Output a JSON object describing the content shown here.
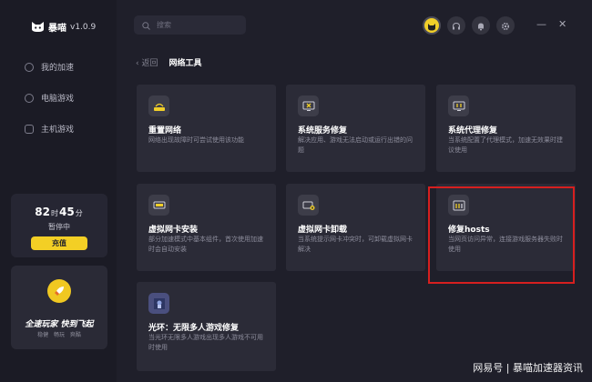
{
  "app": {
    "name": "暴喵",
    "version": "v1.0.9"
  },
  "sidebar": {
    "items": [
      {
        "label": "我的加速",
        "icon": "speed-icon"
      },
      {
        "label": "电脑游戏",
        "icon": "pc-game-icon"
      },
      {
        "label": "主机游戏",
        "icon": "console-icon"
      }
    ],
    "time_card": {
      "hours": "82",
      "hours_unit": "时",
      "minutes": "45",
      "minutes_unit": "分",
      "status": "暂停中",
      "recharge_label": "充值"
    },
    "promo": {
      "title": "全速玩家 快到飞起",
      "subtitle": "稳健 畅玩 爽酷"
    }
  },
  "topbar": {
    "search_placeholder": "搜索",
    "icons": [
      "avatar-icon",
      "headset-icon",
      "bell-icon",
      "settings-icon"
    ],
    "window_controls": {
      "minimize": "—",
      "close": "✕"
    }
  },
  "breadcrumb": {
    "back_label": "返回",
    "title": "网络工具"
  },
  "tools": [
    {
      "title": "重置网络",
      "desc": "网络出现故障时可尝试使用该功能",
      "icon": "network-reset-icon"
    },
    {
      "title": "系统服务修复",
      "desc": "解决应用、游戏无法启动或运行出错的问题",
      "icon": "service-repair-icon"
    },
    {
      "title": "系统代理修复",
      "desc": "当系统配置了代理模式，加速无效果时建议使用",
      "icon": "proxy-repair-icon"
    },
    {
      "title": "虚拟网卡安装",
      "desc": "部分加速模式中基本组件，首次使用加速时会自动安装",
      "icon": "nic-install-icon"
    },
    {
      "title": "虚拟网卡卸载",
      "desc": "当系统提示网卡冲突时，可卸载虚拟网卡解决",
      "icon": "nic-uninstall-icon"
    },
    {
      "title": "修复hosts",
      "desc": "当网页访问异常，连接游戏服务器失败时使用",
      "icon": "hosts-repair-icon"
    },
    {
      "title": "光环：无限多人游戏修复",
      "desc": "当光环无限多人游戏出现多人游戏不可用时使用",
      "icon": "halo-game-icon"
    }
  ],
  "watermark": "网易号 | 暴喵加速器资讯"
}
